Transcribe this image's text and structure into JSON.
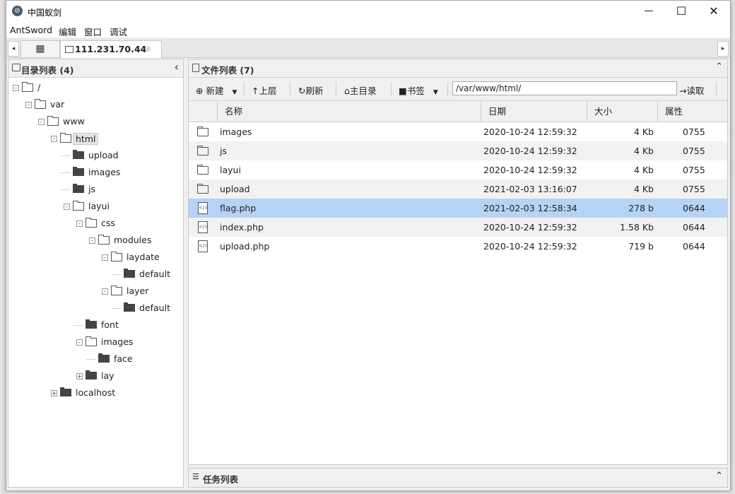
{
  "window": {
    "title": "中国蚁剑",
    "minimize": "—",
    "maximize": "☐",
    "close": "✕"
  },
  "menu": {
    "items": [
      "AntSword",
      "编辑",
      "窗口",
      "调试"
    ]
  },
  "tabs": {
    "home_icon": "grid-icon",
    "host_label": "111.231.70.44",
    "close_symbol": "⊗",
    "left_arrow": "◂",
    "right_arrow": "▸"
  },
  "dir_panel": {
    "title": "目录列表 (4)",
    "collapse_symbol": "‹",
    "tree": [
      {
        "label": "/",
        "depth": 0,
        "expander": "-",
        "icon": "folder-open"
      },
      {
        "label": "var",
        "depth": 1,
        "expander": "-",
        "icon": "folder-open"
      },
      {
        "label": "www",
        "depth": 2,
        "expander": "-",
        "icon": "folder-open"
      },
      {
        "label": "html",
        "depth": 3,
        "expander": "-",
        "icon": "folder-open",
        "selected": true
      },
      {
        "label": "upload",
        "depth": 4,
        "expander": "",
        "icon": "folder-closed"
      },
      {
        "label": "images",
        "depth": 4,
        "expander": "",
        "icon": "folder-closed"
      },
      {
        "label": "js",
        "depth": 4,
        "expander": "",
        "icon": "folder-closed"
      },
      {
        "label": "layui",
        "depth": 4,
        "expander": "-",
        "icon": "folder-open"
      },
      {
        "label": "css",
        "depth": 5,
        "expander": "-",
        "icon": "folder-open"
      },
      {
        "label": "modules",
        "depth": 6,
        "expander": "-",
        "icon": "folder-open"
      },
      {
        "label": "laydate",
        "depth": 7,
        "expander": "-",
        "icon": "folder-open"
      },
      {
        "label": "default",
        "depth": 8,
        "expander": "",
        "icon": "folder-closed"
      },
      {
        "label": "layer",
        "depth": 7,
        "expander": "-",
        "icon": "folder-open"
      },
      {
        "label": "default",
        "depth": 8,
        "expander": "",
        "icon": "folder-closed"
      },
      {
        "label": "font",
        "depth": 5,
        "expander": "",
        "icon": "folder-closed"
      },
      {
        "label": "images",
        "depth": 5,
        "expander": "-",
        "icon": "folder-open"
      },
      {
        "label": "face",
        "depth": 6,
        "expander": "",
        "icon": "folder-closed"
      },
      {
        "label": "lay",
        "depth": 5,
        "expander": "+",
        "icon": "folder-closed"
      },
      {
        "label": "localhost",
        "depth": 3,
        "expander": "+",
        "icon": "folder-closed"
      }
    ]
  },
  "file_panel": {
    "title": "文件列表 (7)",
    "collapse_symbol": "⌃",
    "toolbar": {
      "new_label": "新建",
      "up_label": "上层",
      "refresh_label": "刷新",
      "home_label": "主目录",
      "bookmark_label": "书签",
      "path_value": "/var/www/html/",
      "read_label": "读取"
    },
    "columns": [
      "名称",
      "日期",
      "大小",
      "属性"
    ],
    "rows": [
      {
        "type": "folder",
        "name": "images",
        "date": "2020-10-24 12:59:32",
        "size": "4 Kb",
        "attr": "0755"
      },
      {
        "type": "folder",
        "name": "js",
        "date": "2020-10-24 12:59:32",
        "size": "4 Kb",
        "attr": "0755"
      },
      {
        "type": "folder",
        "name": "layui",
        "date": "2020-10-24 12:59:32",
        "size": "4 Kb",
        "attr": "0755"
      },
      {
        "type": "folder",
        "name": "upload",
        "date": "2021-02-03 13:16:07",
        "size": "4 Kb",
        "attr": "0755"
      },
      {
        "type": "file",
        "name": "flag.php",
        "date": "2021-02-03 12:58:34",
        "size": "278 b",
        "attr": "0644",
        "selected": true
      },
      {
        "type": "file",
        "name": "index.php",
        "date": "2020-10-24 12:59:32",
        "size": "1.58 Kb",
        "attr": "0644"
      },
      {
        "type": "file",
        "name": "upload.php",
        "date": "2020-10-24 12:59:32",
        "size": "719 b",
        "attr": "0644"
      }
    ]
  },
  "task_panel": {
    "title": "任务列表",
    "toggle_symbol": "⌃"
  },
  "colors": {
    "selected_row": "#b5d3f5",
    "alt_row": "#f2f2f2"
  }
}
